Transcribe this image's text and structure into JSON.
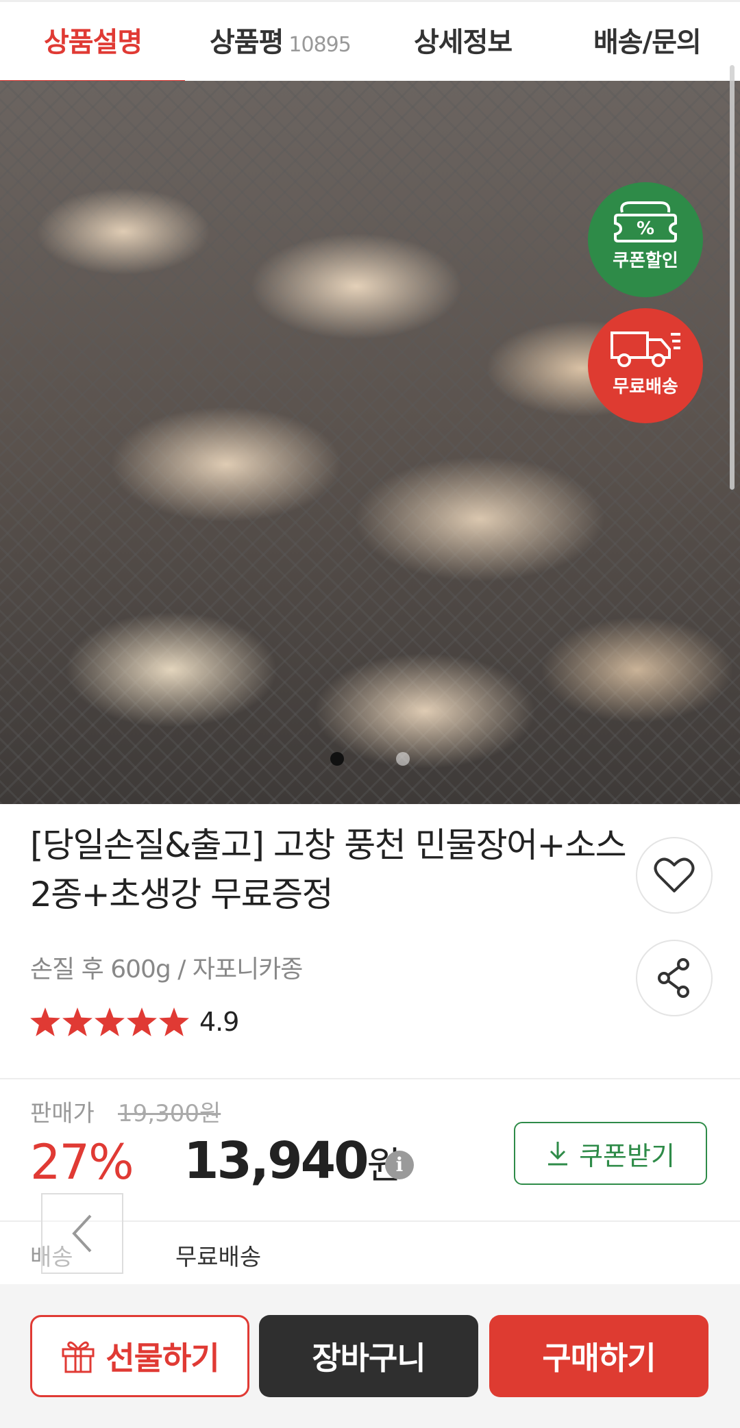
{
  "tabs": {
    "description": "상품설명",
    "reviews": "상품평",
    "review_count": "10895",
    "details": "상세정보",
    "shipping": "배송/문의"
  },
  "hero": {
    "badge_coupon_label": "쿠폰할인",
    "badge_coupon_symbol": "%",
    "badge_ship_label": "무료배송",
    "slide_count": 2,
    "active_slide": 1
  },
  "product": {
    "title": "[당일손질&출고] 고창 풍천 민물장어+소스2종+초생강 무료증정",
    "subtitle": "손질 후 600g / 자포니카종",
    "rating": "4.9",
    "stars": 5
  },
  "price": {
    "label": "판매가",
    "original": "19,300원",
    "discount": "27%",
    "amount": "13,940",
    "currency": "원",
    "info_symbol": "i",
    "coupon_button": "쿠폰받기"
  },
  "shipping": {
    "label": "배송",
    "value": "무료배송"
  },
  "bottom_bar": {
    "gift": "선물하기",
    "cart": "장바구니",
    "buy": "구매하기"
  },
  "colors": {
    "accent_red": "#e03a34",
    "coupon_green": "#2e8b48",
    "dark_button": "#2f2f2f"
  }
}
